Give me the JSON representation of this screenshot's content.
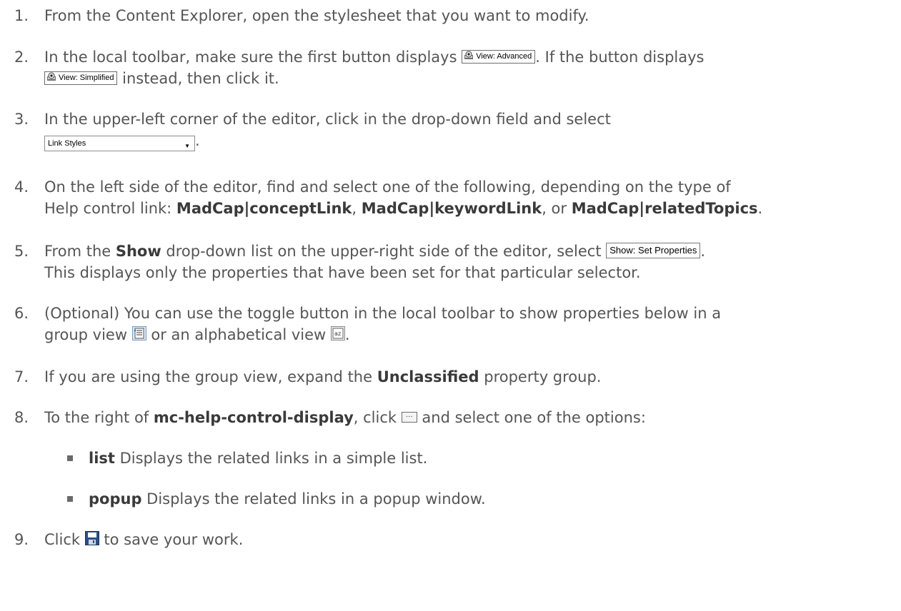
{
  "steps": [
    {
      "num": "1.",
      "text": "From the Content Explorer, open the stylesheet that you want to modify."
    },
    {
      "num": "2.",
      "a": "In the local toolbar, make sure the first button displays ",
      "view_advanced": "View: Advanced",
      "b": ". If the button displays",
      "view_simplified": "View: Simplified",
      "c": " instead, then click it."
    },
    {
      "num": "3.",
      "a": "In the upper-left corner of the editor, click in the drop-down field and select",
      "dropdown": "Link Styles",
      "b": "."
    },
    {
      "num": "4.",
      "a": "On the left side of the editor, find and select one of the following, depending on the type of",
      "b": "Help control link: ",
      "k1": "MadCap|conceptLink",
      "c": ", ",
      "k2": "MadCap|keywordLink",
      "d": ", or ",
      "k3": "MadCap|relatedTopics",
      "e": "."
    },
    {
      "num": "5.",
      "a": "From the ",
      "show": "Show",
      "b": " drop-down list on the upper-right side of the editor, select ",
      "show_btn": "Show: Set Properties",
      "c": ".",
      "line2": "This displays only the properties that have been set for that particular selector."
    },
    {
      "num": "6.",
      "a": "(Optional) You can use the toggle button in the local toolbar to show properties below in a",
      "b": "group view ",
      "c": " or an alphabetical view ",
      "d": "."
    },
    {
      "num": "7.",
      "a": "If you are using the group view, expand the ",
      "group": "Unclassified",
      "b": " property group."
    },
    {
      "num": "8.",
      "a": "To the right of ",
      "prop": "mc-help-control-display",
      "b": ", click ",
      "c": " and select one of the options:"
    },
    {
      "num": "9.",
      "a": "Click ",
      "b": " to save your work."
    }
  ],
  "bullets": [
    {
      "term": "list",
      "desc": " Displays the related links in a simple list."
    },
    {
      "term": "popup",
      "desc": " Displays the related links in a popup window."
    }
  ],
  "icons": {
    "eye": "eye-icon",
    "group": "group-view-icon",
    "alpha": "alphabetical-view-icon",
    "ellipsis": "ellipsis-button-icon",
    "save": "save-icon"
  },
  "colors": {
    "text": "#555555",
    "bold": "#3a3a3a"
  }
}
